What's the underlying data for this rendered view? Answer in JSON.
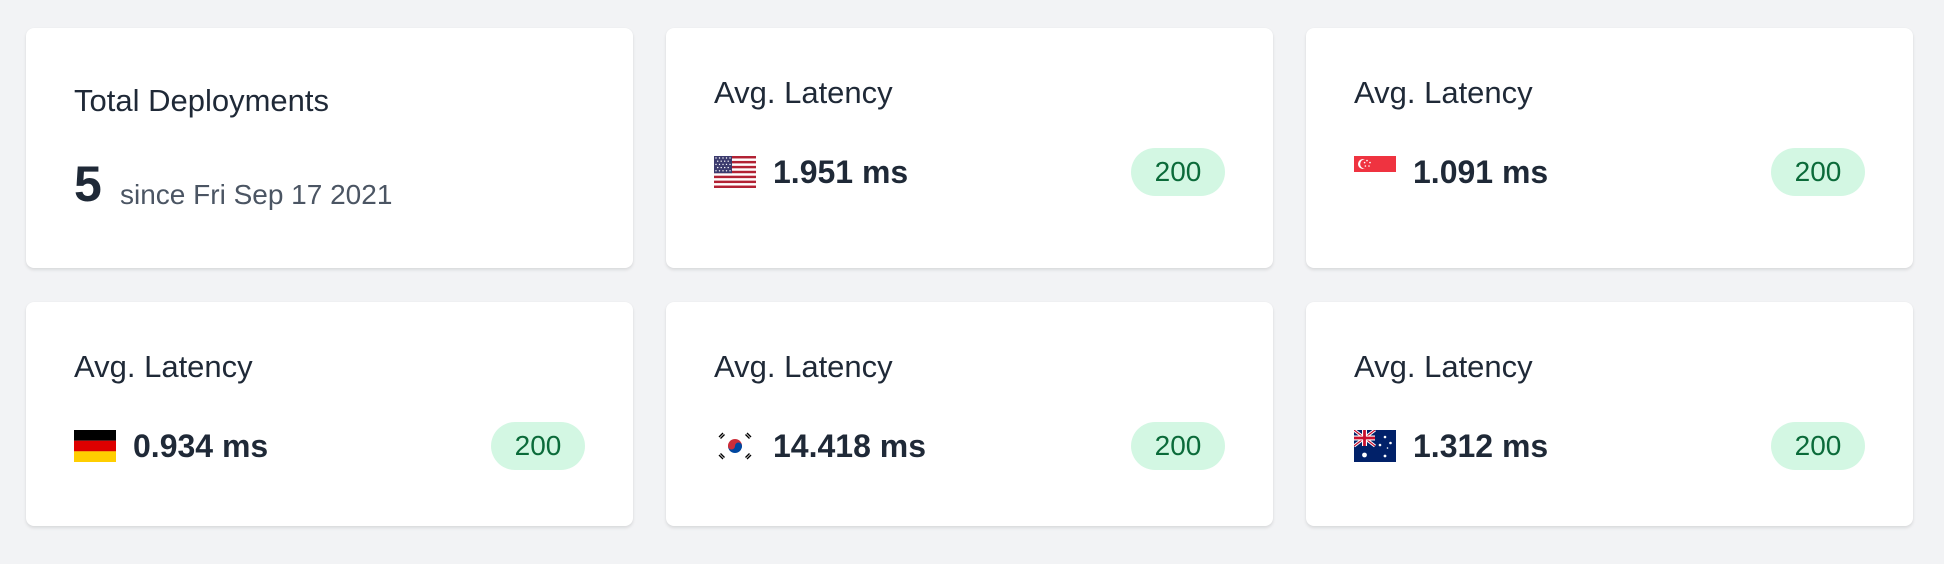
{
  "summary": {
    "title": "Total Deployments",
    "count": "5",
    "since": "since Fri Sep 17 2021"
  },
  "latency_cards": [
    {
      "title": "Avg. Latency",
      "flag_icon": "us-flag-icon",
      "value": "1.951 ms",
      "status": "200"
    },
    {
      "title": "Avg. Latency",
      "flag_icon": "sg-flag-icon",
      "value": "1.091 ms",
      "status": "200"
    },
    {
      "title": "Avg. Latency",
      "flag_icon": "de-flag-icon",
      "value": "0.934 ms",
      "status": "200"
    },
    {
      "title": "Avg. Latency",
      "flag_icon": "kr-flag-icon",
      "value": "14.418 ms",
      "status": "200"
    },
    {
      "title": "Avg. Latency",
      "flag_icon": "au-flag-icon",
      "value": "1.312 ms",
      "status": "200"
    }
  ],
  "colors": {
    "background": "#f2f3f5",
    "card": "#ffffff",
    "badge_bg": "#d3f7e3",
    "badge_text": "#0b6b3a",
    "text": "#1f2937",
    "muted_text": "#4b5563"
  }
}
